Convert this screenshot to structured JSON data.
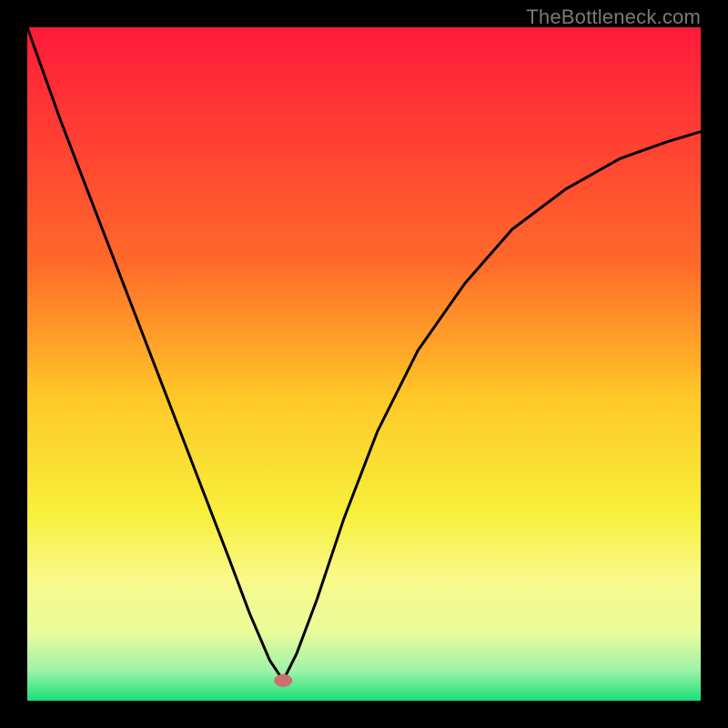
{
  "watermark": "TheBottleneck.com",
  "chart_data": {
    "type": "line",
    "title": "",
    "xlabel": "",
    "ylabel": "",
    "xlim": [
      0,
      100
    ],
    "ylim": [
      0,
      100
    ],
    "gradient_stops": [
      {
        "offset": 0,
        "color": "#ff1a3a"
      },
      {
        "offset": 0.35,
        "color": "#ff6a2a"
      },
      {
        "offset": 0.55,
        "color": "#ffc828"
      },
      {
        "offset": 0.72,
        "color": "#f7ef3a"
      },
      {
        "offset": 0.82,
        "color": "#f8f98a"
      },
      {
        "offset": 0.9,
        "color": "#e8fb9a"
      },
      {
        "offset": 0.955,
        "color": "#9ef3a8"
      },
      {
        "offset": 1.0,
        "color": "#18e07a"
      }
    ],
    "marker": {
      "x": 38,
      "y": 3,
      "color": "#cc6f6f"
    },
    "series": [
      {
        "name": "curve",
        "x": [
          0,
          5,
          10,
          15,
          20,
          25,
          30,
          33,
          36,
          38,
          40,
          43,
          47,
          52,
          58,
          65,
          72,
          80,
          88,
          95,
          100
        ],
        "y": [
          100,
          86,
          73,
          60,
          47,
          34,
          21,
          13,
          6,
          3,
          7,
          15,
          27,
          40,
          52,
          62,
          70,
          76,
          80.5,
          83,
          84.5
        ]
      }
    ]
  }
}
